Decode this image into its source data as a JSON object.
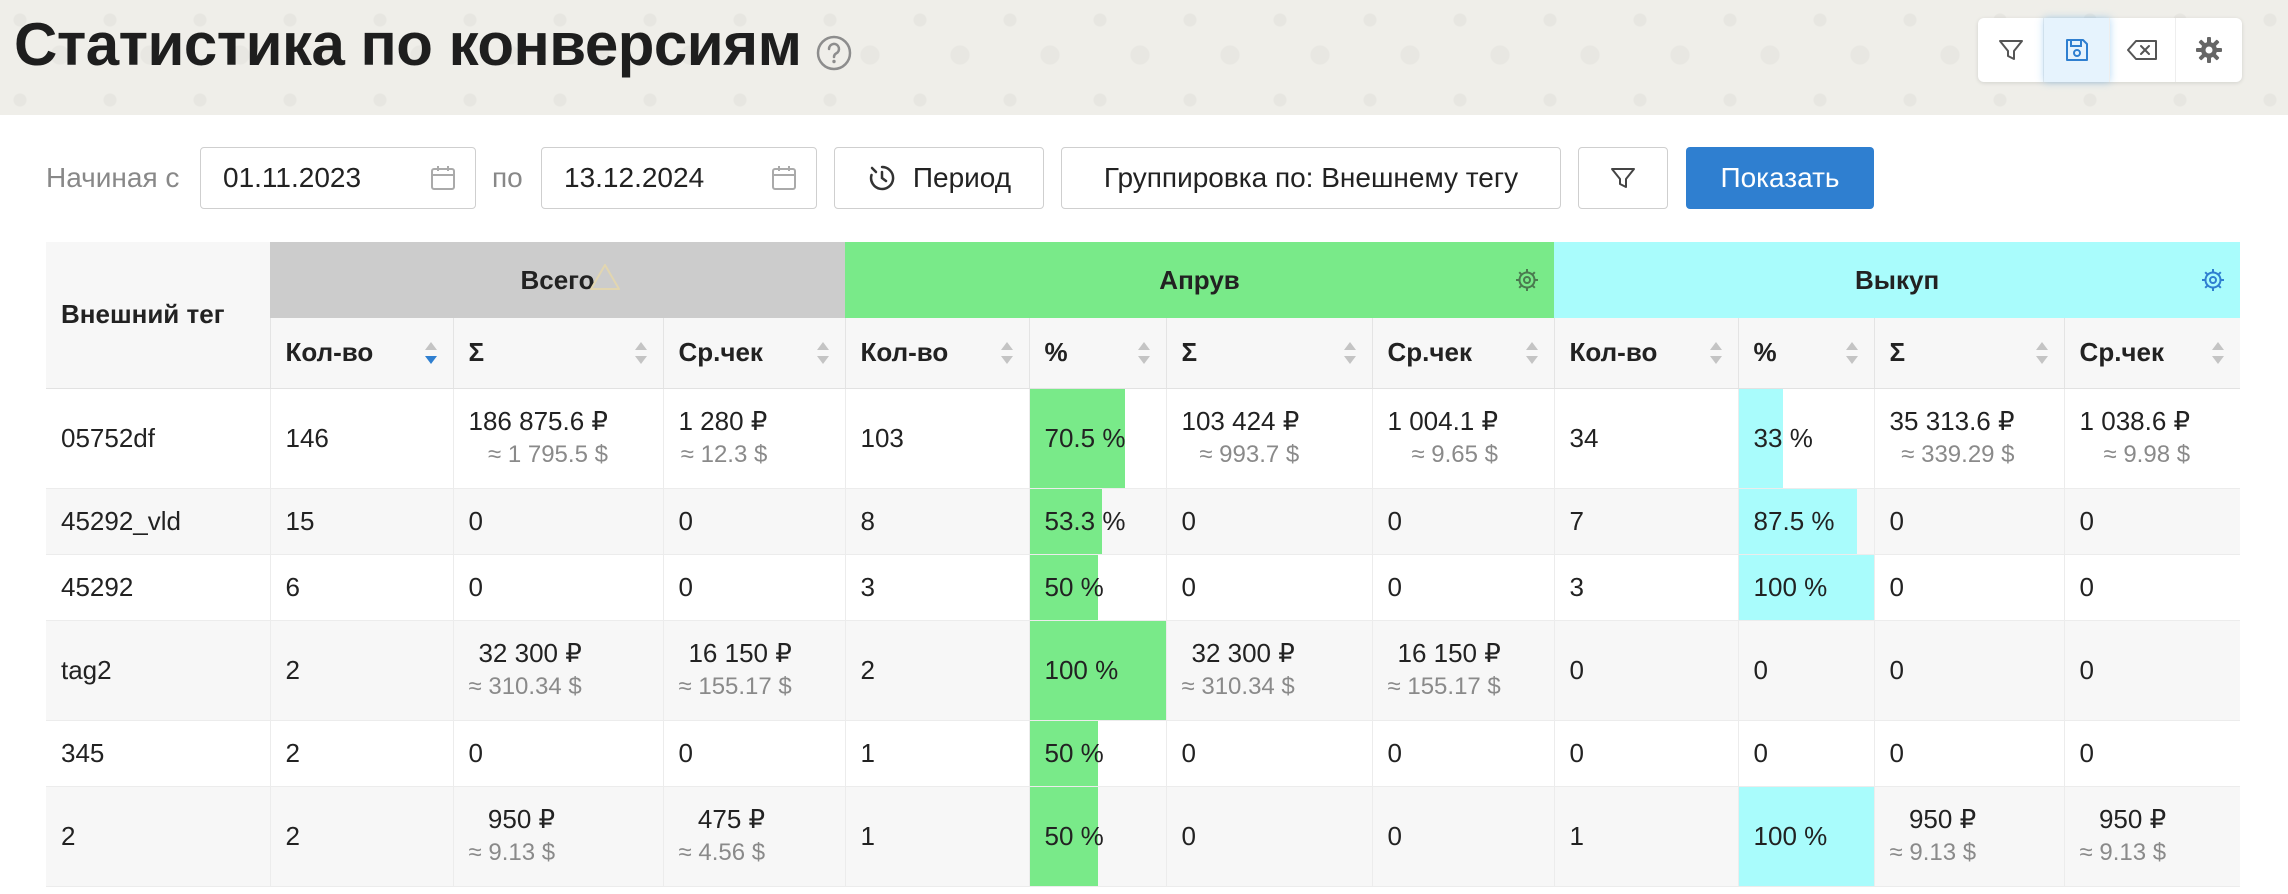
{
  "page": {
    "title": "Статистика по конверсиям"
  },
  "toolbar": {
    "icons": [
      "filter-icon",
      "save-icon",
      "clear-icon",
      "gear-icon"
    ]
  },
  "filters": {
    "from_label": "Начиная с",
    "from_value": "01.11.2023",
    "to_label": "по",
    "to_value": "13.12.2024",
    "period_label": "Период",
    "grouping_label": "Группировка по: Внешнему тегу",
    "show_label": "Показать"
  },
  "colors": {
    "approve": "#79ea89",
    "buyout": "#a9fcfc",
    "total": "#cccccc",
    "primary": "#2f7fd0"
  },
  "table": {
    "row_header": "Внешний тег",
    "groups": {
      "total": "Всего",
      "approve": "Апрув",
      "buyout": "Выкуп"
    },
    "cols": {
      "t_qty": "Кол-во",
      "t_sum": "Σ",
      "t_avg": "Ср.чек",
      "a_qty": "Кол-во",
      "a_pct": "%",
      "a_sum": "Σ",
      "a_avg": "Ср.чек",
      "b_qty": "Кол-во",
      "b_pct": "%",
      "b_sum": "Σ",
      "b_avg": "Ср.чек"
    },
    "rows": [
      {
        "tag": "05752df",
        "t_qty": "146",
        "t_sum": [
          "186 875.6 ₽",
          "≈ 1 795.5 $"
        ],
        "t_avg": [
          "1 280 ₽",
          "≈ 12.3 $"
        ],
        "a_qty": "103",
        "a_pct": "70.5 %",
        "a_pct_value": 70.5,
        "a_sum": [
          "103 424 ₽",
          "≈ 993.7 $"
        ],
        "a_avg": [
          "1 004.1 ₽",
          "≈ 9.65 $"
        ],
        "b_qty": "34",
        "b_pct": "33 %",
        "b_pct_value": 33,
        "b_sum": [
          "35 313.6 ₽",
          "≈ 339.29 $"
        ],
        "b_avg": [
          "1 038.6 ₽",
          "≈ 9.98 $"
        ]
      },
      {
        "tag": "45292_vld",
        "t_qty": "15",
        "t_sum": [
          "0"
        ],
        "t_avg": [
          "0"
        ],
        "a_qty": "8",
        "a_pct": "53.3 %",
        "a_pct_value": 53.3,
        "a_sum": [
          "0"
        ],
        "a_avg": [
          "0"
        ],
        "b_qty": "7",
        "b_pct": "87.5 %",
        "b_pct_value": 87.5,
        "b_sum": [
          "0"
        ],
        "b_avg": [
          "0"
        ]
      },
      {
        "tag": "45292",
        "t_qty": "6",
        "t_sum": [
          "0"
        ],
        "t_avg": [
          "0"
        ],
        "a_qty": "3",
        "a_pct": "50 %",
        "a_pct_value": 50,
        "a_sum": [
          "0"
        ],
        "a_avg": [
          "0"
        ],
        "b_qty": "3",
        "b_pct": "100 %",
        "b_pct_value": 100,
        "b_sum": [
          "0"
        ],
        "b_avg": [
          "0"
        ]
      },
      {
        "tag": "tag2",
        "t_qty": "2",
        "t_sum": [
          "32 300 ₽",
          "≈ 310.34 $"
        ],
        "t_avg": [
          "16 150 ₽",
          "≈ 155.17 $"
        ],
        "a_qty": "2",
        "a_pct": "100 %",
        "a_pct_value": 100,
        "a_sum": [
          "32 300 ₽",
          "≈ 310.34 $"
        ],
        "a_avg": [
          "16 150 ₽",
          "≈ 155.17 $"
        ],
        "b_qty": "0",
        "b_pct": "0",
        "b_pct_value": 0,
        "b_sum": [
          "0"
        ],
        "b_avg": [
          "0"
        ]
      },
      {
        "tag": "345",
        "t_qty": "2",
        "t_sum": [
          "0"
        ],
        "t_avg": [
          "0"
        ],
        "a_qty": "1",
        "a_pct": "50 %",
        "a_pct_value": 50,
        "a_sum": [
          "0"
        ],
        "a_avg": [
          "0"
        ],
        "b_qty": "0",
        "b_pct": "0",
        "b_pct_value": 0,
        "b_sum": [
          "0"
        ],
        "b_avg": [
          "0"
        ]
      },
      {
        "tag": "2",
        "t_qty": "2",
        "t_sum": [
          "950 ₽",
          "≈ 9.13 $"
        ],
        "t_avg": [
          "475 ₽",
          "≈ 4.56 $"
        ],
        "a_qty": "1",
        "a_pct": "50 %",
        "a_pct_value": 50,
        "a_sum": [
          "0"
        ],
        "a_avg": [
          "0"
        ],
        "b_qty": "1",
        "b_pct": "100 %",
        "b_pct_value": 100,
        "b_sum": [
          "950 ₽",
          "≈ 9.13 $"
        ],
        "b_avg": [
          "950 ₽",
          "≈ 9.13 $"
        ]
      }
    ]
  }
}
